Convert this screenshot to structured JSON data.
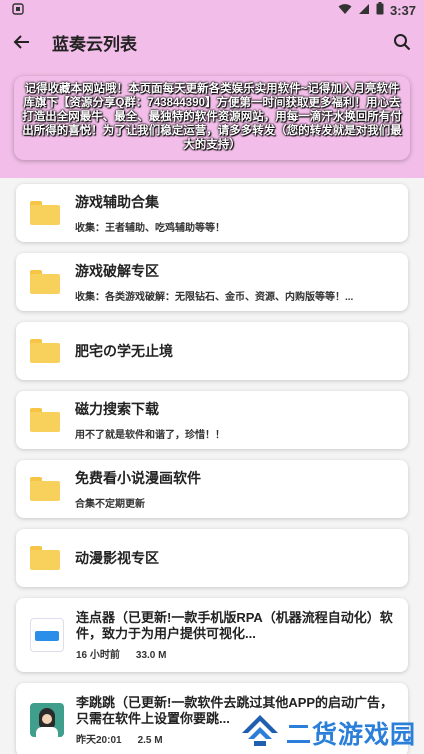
{
  "status_bar": {
    "left_icon": "notification-icon",
    "time": "3:37",
    "icons": [
      "wifi-icon",
      "signal-icon",
      "battery-icon"
    ]
  },
  "app_bar": {
    "title": "蓝奏云列表",
    "back_icon": "arrow-left-icon",
    "search_icon": "search-icon"
  },
  "notice": {
    "text": "记得收藏本网站哦！本页面每天更新各类娱乐实用软件~记得加入月亮软件库旗下【资源分享Q群：743844390】方便第一时间获取更多福利！用心去打造出全网最牛、最全、最独特的软件资源网站，用每一滴汗水换回所有付出所得的喜悦！为了让我们稳定运营，请多多转发（您的转发就是对我们最大的支持）"
  },
  "folders": [
    {
      "title": "游戏辅助合集",
      "subtitle": "收集：王者辅助、吃鸡辅助等等！"
    },
    {
      "title": "游戏破解专区",
      "subtitle": "收集：各类游戏破解：无限钻石、金币、资源、内购版等等！..."
    },
    {
      "title": "肥宅の学无止境",
      "subtitle": ""
    },
    {
      "title": "磁力搜索下载",
      "subtitle": "用不了就是软件和谐了，珍惜！！"
    },
    {
      "title": "免费看小说漫画软件",
      "subtitle": "合集不定期更新"
    },
    {
      "title": "动漫影视专区",
      "subtitle": ""
    }
  ],
  "files": [
    {
      "title": "连点器（已更新!一款手机版RPA（机器流程自动化）软件，致力于为用户提供可视化...",
      "time": "16 小时前",
      "size": "33.0 M",
      "icon": "autoclicker-app-icon"
    },
    {
      "title": "李跳跳（已更新!一款软件去跳过其他APP的启动广告，只需在软件上设置你要跳...",
      "time": "昨天20:01",
      "size": "2.5 M",
      "icon": "litiaotiao-app-icon"
    }
  ],
  "watermark": {
    "text": "二货游戏园",
    "logo": "watermark-logo-icon"
  },
  "colors": {
    "accent": "#f2bde8",
    "folder": "#f8d15c",
    "watermark": "#2b7fd9"
  }
}
